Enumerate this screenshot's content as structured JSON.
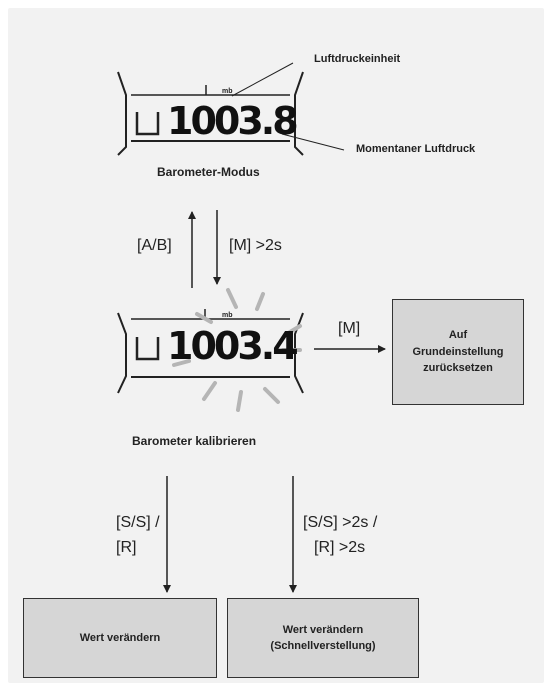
{
  "top_display": {
    "digits": "1003.8",
    "unit": "mb",
    "label_unit": "Luftdruckeinheit",
    "label_pressure": "Momentaner Luftdruck",
    "caption": "Barometer-Modus"
  },
  "transitions": {
    "up": "[A/B]",
    "down": "[M] >2s",
    "right": "[M]",
    "left_down_line1": "[S/S] /",
    "left_down_line2": "[R]",
    "right_down_line1": "[S/S] >2s /",
    "right_down_line2": "[R] >2s"
  },
  "calibrate_display": {
    "digits": "1003.4",
    "unit": "mb",
    "caption": "Barometer kalibrieren"
  },
  "boxes": {
    "reset_line1": "Auf",
    "reset_line2": "Grundeinstellung",
    "reset_line3": "zurücksetzen",
    "change": "Wert verändern",
    "fast_line1": "Wert verändern",
    "fast_line2": "(Schnellverstellung)"
  },
  "colors": {
    "background": "#f2f2f2",
    "box_fill": "#d6d6d6",
    "flash_rays": "#b5b5b5"
  }
}
